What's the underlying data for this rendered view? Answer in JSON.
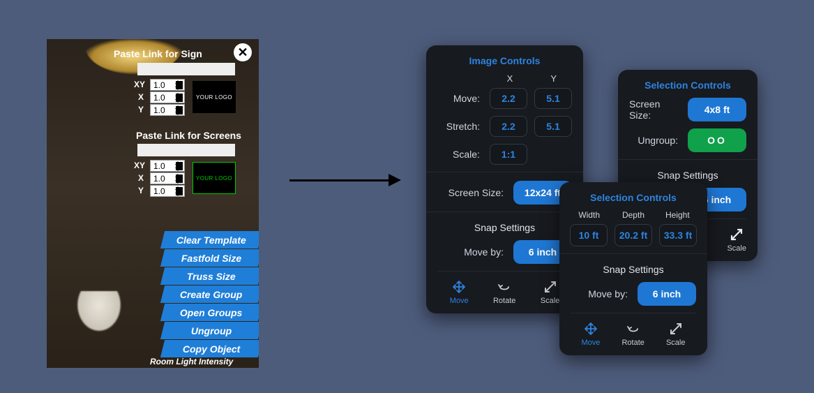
{
  "oldPanel": {
    "signLabel": "Paste Link for Sign",
    "screensLabel": "Paste Link for Screens",
    "axis": {
      "xy": "XY",
      "x": "X",
      "y": "Y"
    },
    "signValues": {
      "xy": "1.0",
      "x": "1.0",
      "y": "1.0"
    },
    "screenValues": {
      "xy": "1.0",
      "x": "1.0",
      "y": "1.0"
    },
    "logoText": "YOUR LOGO",
    "actions": [
      "Clear Template",
      "Fastfold Size",
      "Truss Size",
      "Create Group",
      "Open Groups",
      "Ungroup",
      "Copy Object"
    ],
    "roomLight": "Room Light Intensity"
  },
  "imageControls": {
    "title": "Image Controls",
    "xHead": "X",
    "yHead": "Y",
    "moveLabel": "Move:",
    "moveX": "2.2",
    "moveY": "5.1",
    "stretchLabel": "Stretch:",
    "stretchX": "2.2",
    "stretchY": "5.1",
    "scaleLabel": "Scale:",
    "scaleVal": "1:1",
    "sizeLabel": "Screen Size:",
    "sizeVal": "12x24 ft",
    "snapTitle": "Snap Settings",
    "moveByLabel": "Move by:",
    "moveByVal": "6 inch",
    "tools": {
      "move": "Move",
      "rotate": "Rotate",
      "scale": "Scale"
    }
  },
  "selectionA": {
    "title": "Selection Controls",
    "sizeLabel": "Screen Size:",
    "sizeVal": "4x8 ft",
    "ungroupLabel": "Ungroup:",
    "ungroupVal": "OO",
    "snapTitle": "Snap Settings",
    "moveByVal": "6 inch",
    "tools": {
      "scale": "Scale"
    }
  },
  "selectionB": {
    "title": "Selection Controls",
    "widthHead": "Width",
    "depthHead": "Depth",
    "heightHead": "Height",
    "widthVal": "10 ft",
    "depthVal": "20.2 ft",
    "heightVal": "33.3 ft",
    "snapTitle": "Snap Settings",
    "moveByLabel": "Move by:",
    "moveByVal": "6 inch",
    "tools": {
      "move": "Move",
      "rotate": "Rotate",
      "scale": "Scale"
    }
  }
}
